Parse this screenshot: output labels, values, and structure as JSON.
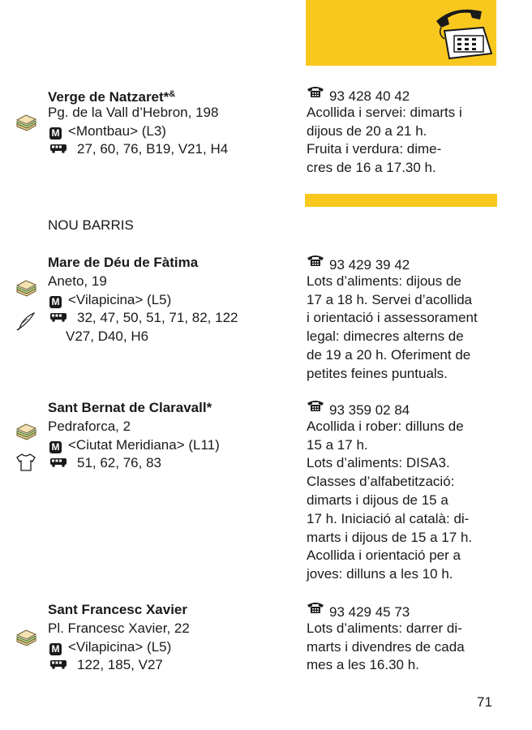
{
  "page_number": "71",
  "section_title": "NOU BARRIS",
  "entries": [
    {
      "name": "Verge de Natzaret*",
      "name_sup": "&",
      "address": "Pg. de la Vall d’Hebron, 198",
      "metro": "<Montbau> (L3)",
      "bus": "27, 60, 76, B19, V21, H4",
      "phone": "93 428 40 42",
      "details": [
        "Acollida i servei: dimarts i",
        "dijous de 20 a 21 h.",
        "Fruita i verdura: dime-",
        "cres de 16 a 17.30 h."
      ]
    },
    {
      "name": "Mare de Déu de Fàtima",
      "address": "Aneto, 19",
      "metro": "<Vilapicina> (L5)",
      "bus": "32, 47, 50, 51, 71, 82, 122",
      "bus2": "V27, D40, H6",
      "phone": "93 429 39 42",
      "details": [
        "Lots d’aliments: dijous de",
        "17 a 18 h. Servei d’acollida",
        "i orientació i assessorament",
        "legal: dimecres alterns de",
        "de 19 a 20 h. Oferiment de",
        "petites feines puntuals."
      ]
    },
    {
      "name": "Sant Bernat de Claravall*",
      "address": "Pedraforca, 2",
      "metro": "<Ciutat Meridiana> (L11)",
      "bus": "51, 62, 76, 83",
      "phone": "93 359 02 84",
      "details": [
        "Acollida i rober: dilluns de",
        "15 a 17 h.",
        "Lots d’aliments: DISA3.",
        "Classes d’alfabetització:",
        "dimarts i dijous de 15 a",
        "17 h. Iniciació al català: di-",
        "marts i dijous de 15 a 17 h.",
        "Acollida i orientació per a",
        "joves: dilluns a les 10 h."
      ]
    },
    {
      "name": "Sant Francesc Xavier",
      "address": "Pl. Francesc Xavier, 22",
      "metro": "<Vilapicina> (L5)",
      "bus": "122, 185, V27",
      "phone": "93 429 45 73",
      "details": [
        "Lots d’aliments: darrer di-",
        "marts i divendres de cada",
        "mes a les 16.30 h."
      ]
    }
  ]
}
